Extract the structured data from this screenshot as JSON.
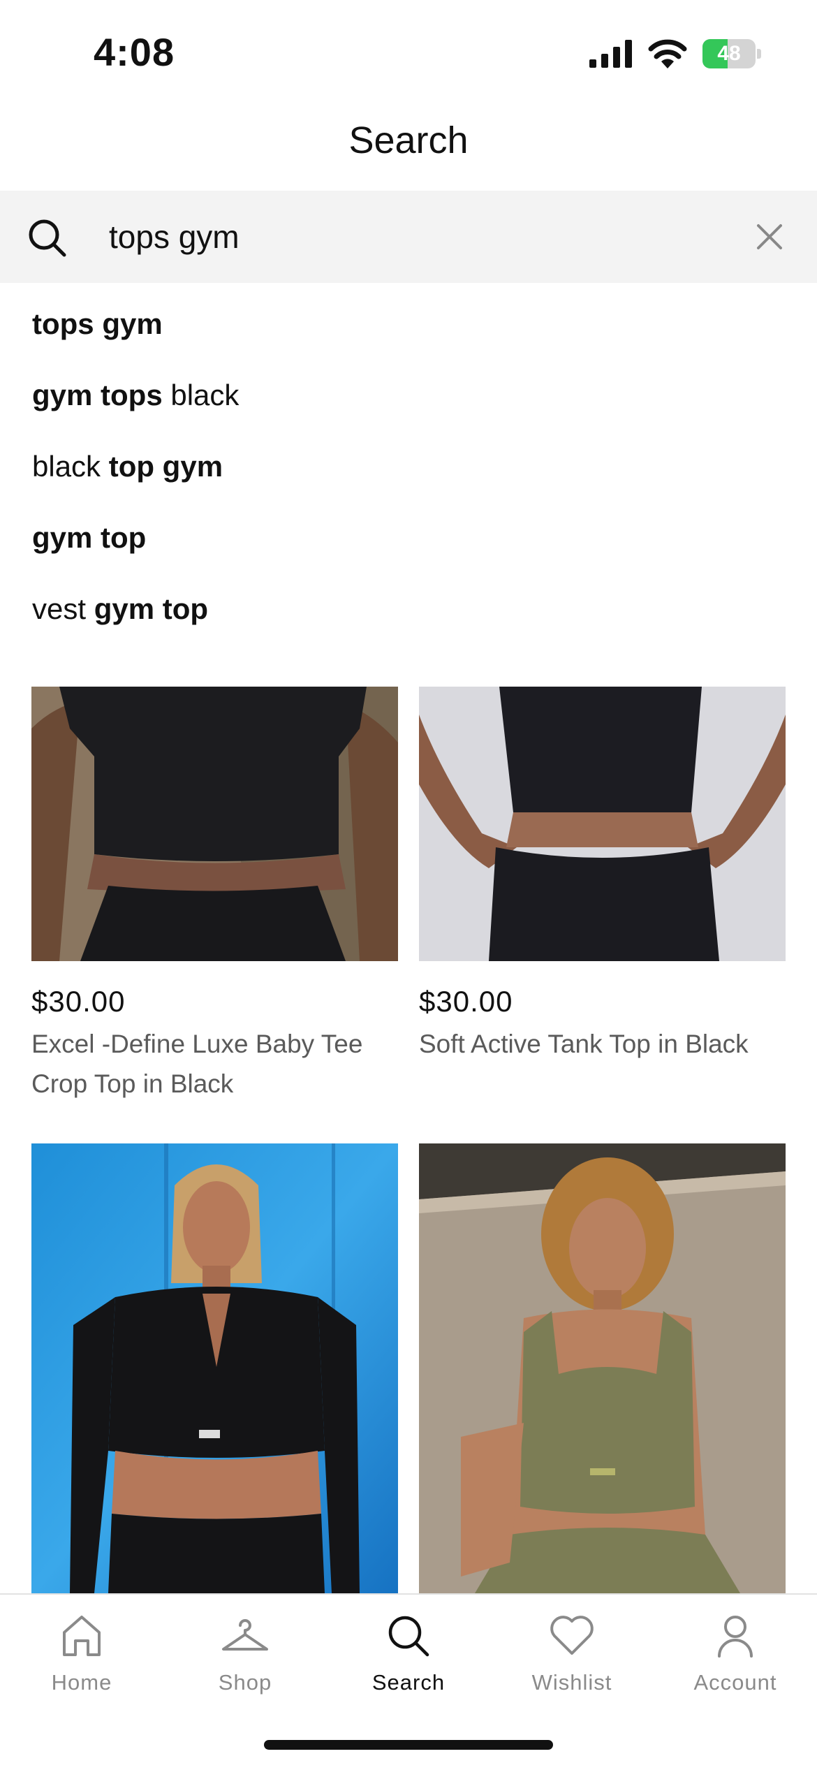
{
  "status_bar": {
    "time": "4:08",
    "battery": "48",
    "battery_level": 0.48
  },
  "header": {
    "title": "Search"
  },
  "search": {
    "query": "tops gym"
  },
  "suggestions": [
    {
      "parts": [
        {
          "text": "tops gym",
          "bold": true
        }
      ]
    },
    {
      "parts": [
        {
          "text": "gym tops",
          "bold": true
        },
        {
          "text": " black",
          "bold": false
        }
      ]
    },
    {
      "parts": [
        {
          "text": "black ",
          "bold": false
        },
        {
          "text": "top gym",
          "bold": true
        }
      ]
    },
    {
      "parts": [
        {
          "text": "gym top",
          "bold": true
        }
      ]
    },
    {
      "parts": [
        {
          "text": "vest ",
          "bold": false
        },
        {
          "text": "gym top",
          "bold": true
        }
      ]
    }
  ],
  "products": [
    {
      "price": "$30.00",
      "name": "Excel -Define Luxe Baby Tee Crop Top in Black"
    },
    {
      "price": "$30.00",
      "name": "Soft Active Tank Top in Black"
    },
    {
      "price": "",
      "name": ""
    },
    {
      "price": "",
      "name": ""
    }
  ],
  "tab_bar": {
    "tabs": [
      {
        "label": "Home",
        "icon": "home-icon"
      },
      {
        "label": "Shop",
        "icon": "hanger-icon"
      },
      {
        "label": "Search",
        "icon": "search-icon",
        "active": true
      },
      {
        "label": "Wishlist",
        "icon": "heart-icon"
      },
      {
        "label": "Account",
        "icon": "person-icon"
      }
    ]
  }
}
